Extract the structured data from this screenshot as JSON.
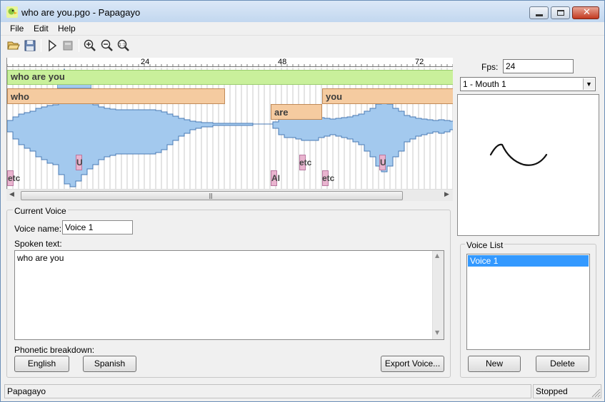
{
  "window": {
    "title": "who are you.pgo - Papagayo"
  },
  "menu": [
    "File",
    "Edit",
    "Help"
  ],
  "toolbar": {
    "icons": [
      "open-icon",
      "save-icon",
      "play-icon",
      "stop-icon",
      "zoom-in-icon",
      "zoom-out-icon",
      "zoom-reset-icon"
    ]
  },
  "timeline": {
    "ruler_labels": [
      "24",
      "48",
      "72"
    ],
    "phrase": "who are you",
    "words": [
      "who",
      "are",
      "you"
    ],
    "phonemes": [
      "etc",
      "U",
      "AI",
      "etc",
      "etc",
      "U"
    ],
    "colors": {
      "phrase": "#c9f09b",
      "word": "#f5cba0",
      "phoneme": "#e9b4cf",
      "waveform": "#a3c9ee"
    }
  },
  "fps": {
    "label": "Fps:",
    "value": "24"
  },
  "mouth": {
    "selected": "1 - Mouth 1"
  },
  "current_voice": {
    "group_title": "Current Voice",
    "name_label": "Voice name:",
    "name_value": "Voice 1",
    "spoken_label": "Spoken text:",
    "spoken_value": "who are you",
    "phonetic_label": "Phonetic breakdown:",
    "btn_english": "English",
    "btn_spanish": "Spanish",
    "btn_export": "Export Voice..."
  },
  "voice_list": {
    "group_title": "Voice List",
    "items": [
      "Voice 1"
    ],
    "btn_new": "New",
    "btn_delete": "Delete"
  },
  "status": {
    "left": "Papagayo",
    "right": "Stopped"
  }
}
